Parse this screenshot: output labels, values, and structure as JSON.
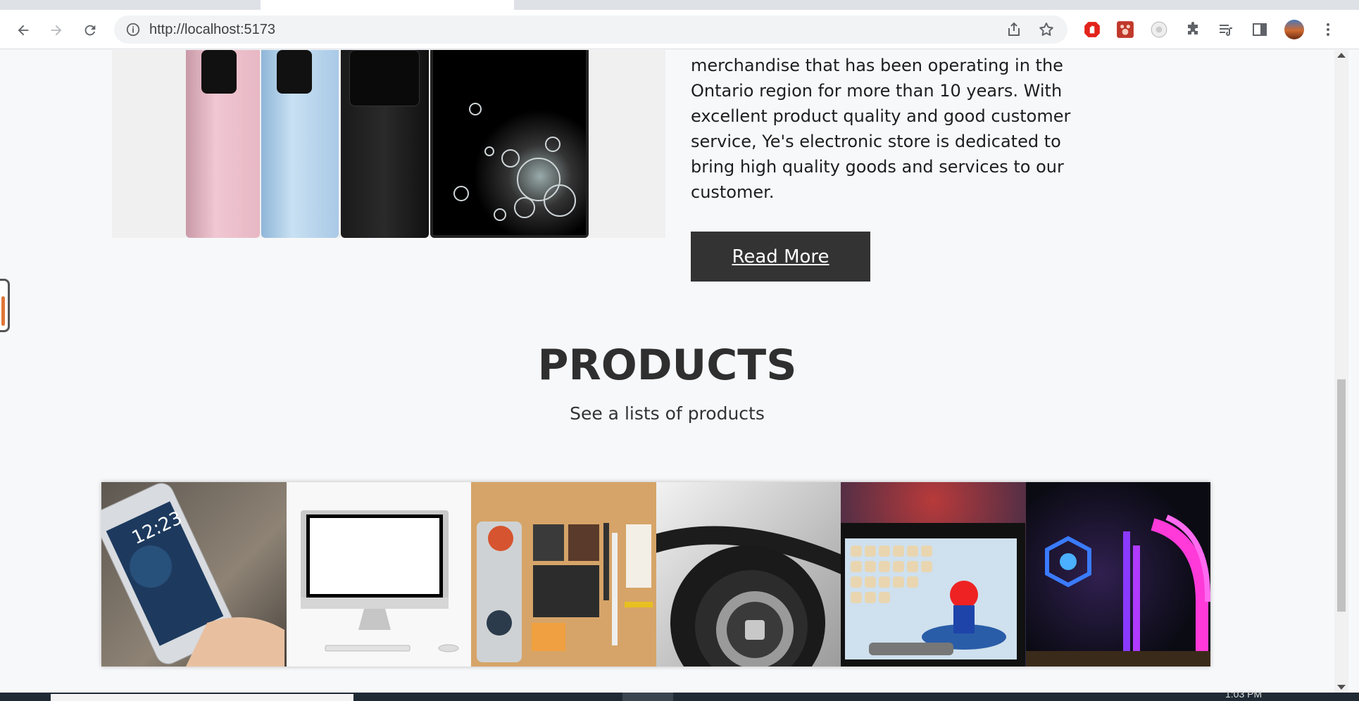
{
  "browser": {
    "url": "http://localhost:5173"
  },
  "icons": {
    "back": "arrow-left-icon",
    "forward": "arrow-right-icon",
    "reload": "reload-icon",
    "info": "info-icon",
    "share": "share-icon",
    "bookmark": "star-icon",
    "extensions": [
      "adblock-icon",
      "paw-extension-icon",
      "dev-extension-icon",
      "puzzle-icon",
      "media-queue-icon",
      "side-panel-icon",
      "profile-avatar",
      "kebab-menu-icon"
    ]
  },
  "about": {
    "text": "merchandise that has been operating in the Ontario region for more than 10 years. With excellent product quality and good customer service, Ye's electronic store is dedicated to bring high quality goods and services to our customer.",
    "button_label": "Read More"
  },
  "products": {
    "title": "PRODUCTS",
    "subtitle": "See a lists of products",
    "tiles": [
      "iphone-in-hand",
      "imac-desktop",
      "desk-accessories",
      "headphones",
      "nintendo-mario-kart",
      "gaming-pc-rgb"
    ]
  },
  "taskbar": {
    "clock": "1:03 PM"
  },
  "colors": {
    "page_bg": "#f7f8fa",
    "button_bg": "#333333",
    "button_text": "#ffffff",
    "heading": "#2f2f2f"
  }
}
